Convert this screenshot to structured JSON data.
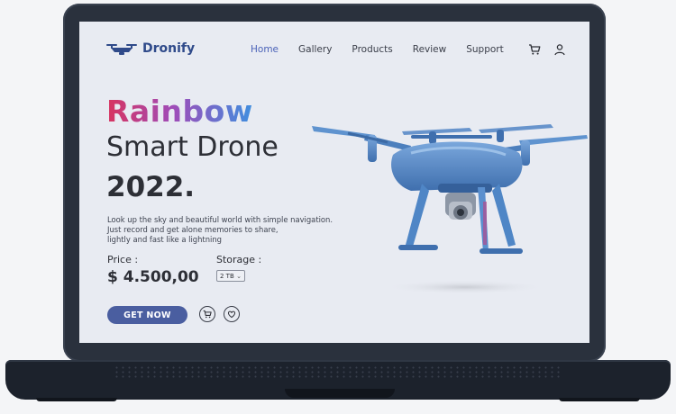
{
  "brand": {
    "name": "Dronify"
  },
  "nav": {
    "items": [
      {
        "label": "Home",
        "active": true
      },
      {
        "label": "Gallery",
        "active": false
      },
      {
        "label": "Products",
        "active": false
      },
      {
        "label": "Review",
        "active": false
      },
      {
        "label": "Support",
        "active": false
      }
    ],
    "icons": [
      "cart-icon",
      "user-icon"
    ]
  },
  "hero": {
    "title_highlight": "Rainbow",
    "title_line2": "Smart Drone",
    "title_line3": "2022.",
    "description": [
      "Look up  the sky and beautiful world with simple navigation.",
      "Just record and get alone memories to share,",
      "lightly and fast like a lightning"
    ],
    "price_label": "Price :",
    "price_value": "$ 4.500,00",
    "storage_label": "Storage :",
    "storage_selected": "2 TB",
    "cta_label": "GET NOW",
    "actions": [
      "add-to-cart-icon",
      "favorite-icon"
    ]
  },
  "colors": {
    "accent": "#4a5ea0",
    "brand": "#2f4a8a",
    "nav_active": "#4b63b8",
    "gradient": [
      "#d8345f",
      "#a04cb8",
      "#3f8fdf"
    ],
    "drone": "#4f86c6"
  }
}
